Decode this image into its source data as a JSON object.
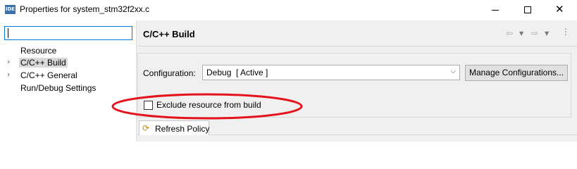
{
  "window": {
    "app_icon_text": "IDE",
    "title": "Properties for system_stm32f2xx.c",
    "controls": {
      "minimize": "minimize",
      "maximize": "maximize",
      "close": "✕"
    }
  },
  "sidebar": {
    "filter": {
      "value": "",
      "placeholder": ""
    },
    "items": [
      {
        "label": "Resource",
        "expandable": false,
        "selected": false
      },
      {
        "label": "C/C++ Build",
        "expandable": true,
        "selected": true
      },
      {
        "label": "C/C++ General",
        "expandable": true,
        "selected": false
      },
      {
        "label": "Run/Debug Settings",
        "expandable": false,
        "selected": false
      }
    ]
  },
  "page": {
    "title": "C/C++ Build",
    "nav_icons": [
      "back-arrow-icon",
      "back-dropdown-icon",
      "forward-arrow-icon",
      "forward-dropdown-icon",
      "view-menu-icon"
    ]
  },
  "configuration": {
    "label": "Configuration:",
    "value": "Debug  [ Active ]",
    "manage_button": "Manage Configurations..."
  },
  "exclude": {
    "label": "Exclude resource from build",
    "checked": false
  },
  "tabs": [
    {
      "label": "Refresh Policy",
      "icon": "refresh-policy-icon"
    }
  ],
  "colors": {
    "annotation": "#e3141b",
    "selection": "#d9d9d9",
    "focus": "#0078d7",
    "panel": "#f0f0f0"
  }
}
